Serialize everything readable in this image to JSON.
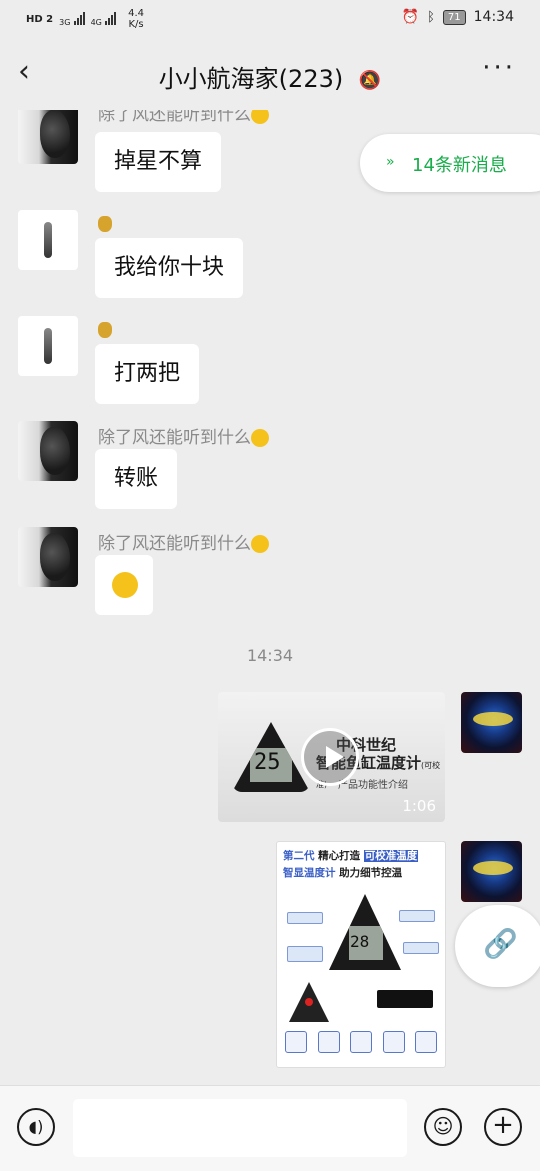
{
  "status_bar": {
    "left_badges": "HD 2",
    "sig1": "3G",
    "sig2": "4G",
    "net_speed": "4.4",
    "net_unit": "K/s",
    "battery": "71",
    "time": "14:34",
    "icons": [
      "alarm-icon",
      "bluetooth-icon",
      "battery-icon"
    ]
  },
  "header": {
    "title": "小小航海家(223)",
    "back_icon": "back-icon",
    "mute_icon": "mute-bell-icon",
    "more_icon": "more-icon"
  },
  "new_messages": {
    "arrow": "»",
    "label": "14条新消息"
  },
  "messages": [
    {
      "sender": "除了风还能听到什么",
      "text": "掉星不算",
      "avatar": "face-avatar"
    },
    {
      "sender": "",
      "text": "我给你十块",
      "avatar": "dancer-avatar"
    },
    {
      "sender": "",
      "text": "打两把",
      "avatar": "dancer-avatar"
    },
    {
      "sender": "除了风还能听到什么",
      "text": "转账",
      "avatar": "face-avatar"
    },
    {
      "sender": "除了风还能听到什么",
      "text": "",
      "avatar": "face-avatar"
    }
  ],
  "timestamp": "14:34",
  "video": {
    "title_line1": "中科世纪",
    "title_line2": "智能鱼缸温度计",
    "title_suffix": "(可校准)",
    "subtitle": "产品功能性介绍",
    "reading": "25",
    "duration": "1:06"
  },
  "poster": {
    "line1_a": "第二代",
    "line1_b": "精心打造",
    "line1_c": "可校准温度",
    "line2_a": "智显温度计",
    "line2_b": "助力细节控温",
    "reading": "28"
  },
  "input_bar": {
    "voice_icon": "voice-icon",
    "emoji_icon": "emoji-icon",
    "plus_icon": "plus-icon"
  },
  "colors": {
    "accent_green": "#1aad4b",
    "poster_blue": "#3a5fc7",
    "background": "#ededed"
  }
}
